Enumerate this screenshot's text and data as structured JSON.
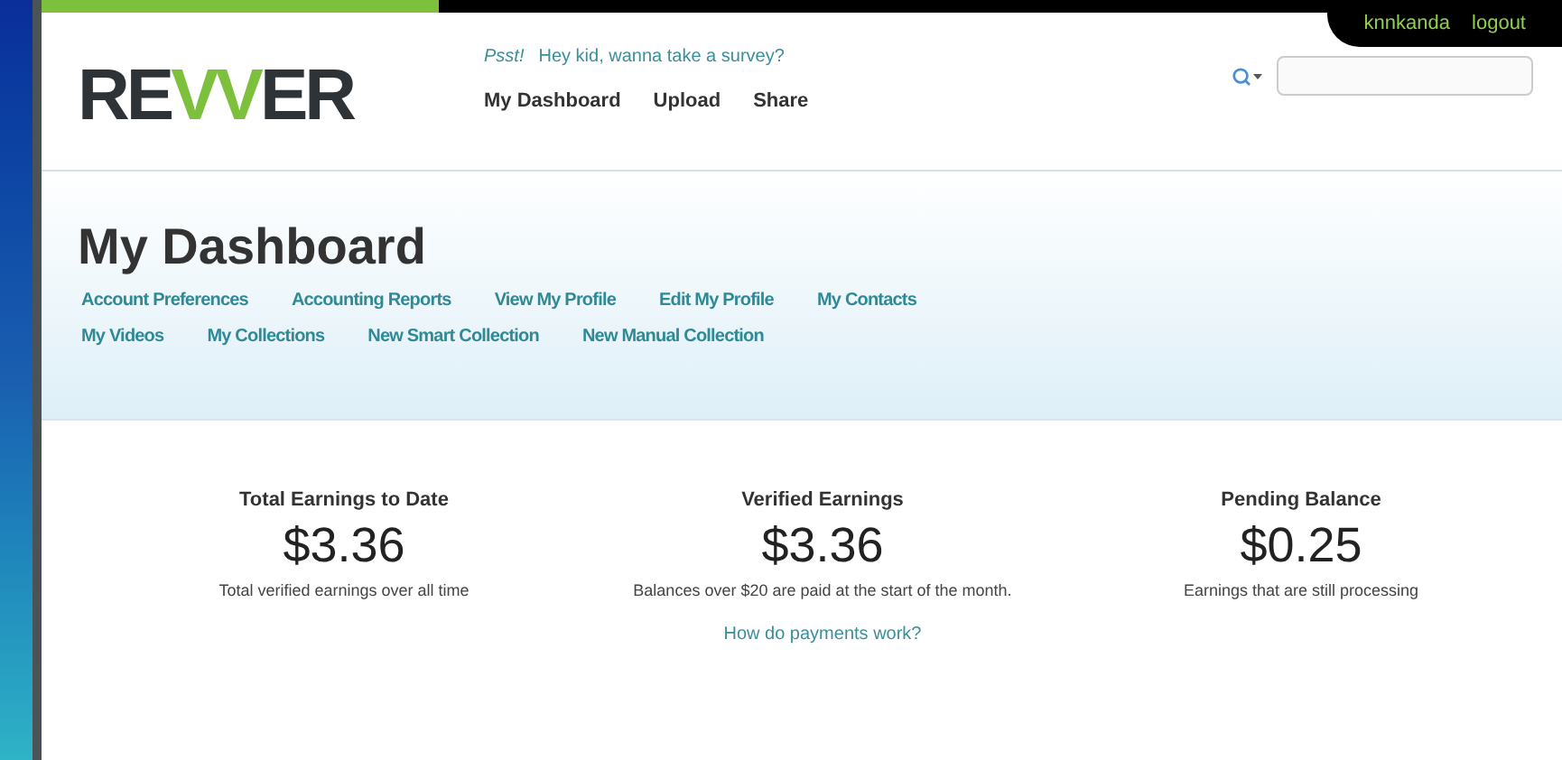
{
  "user_bar": {
    "username": "knnkanda",
    "logout": "logout"
  },
  "logo": {
    "text": "REVVER"
  },
  "promo": {
    "prefix": "Psst!",
    "text": "Hey kid, wanna take a survey?"
  },
  "main_nav": [
    {
      "label": "My Dashboard"
    },
    {
      "label": "Upload"
    },
    {
      "label": "Share"
    }
  ],
  "page_title": "My Dashboard",
  "sub_nav_rows": [
    [
      "Account Preferences",
      "Accounting Reports",
      "View My Profile",
      "Edit My Profile",
      "My Contacts"
    ],
    [
      "My Videos",
      "My Collections",
      "New Smart Collection",
      "New Manual Collection"
    ]
  ],
  "stats": [
    {
      "title": "Total Earnings to Date",
      "amount": "$3.36",
      "note": "Total verified earnings over all time"
    },
    {
      "title": "Verified Earnings",
      "amount": "$3.36",
      "note": "Balances over $20 are paid at the start of the month.",
      "link": "How do payments work?"
    },
    {
      "title": "Pending Balance",
      "amount": "$0.25",
      "note": "Earnings that are still processing"
    }
  ]
}
